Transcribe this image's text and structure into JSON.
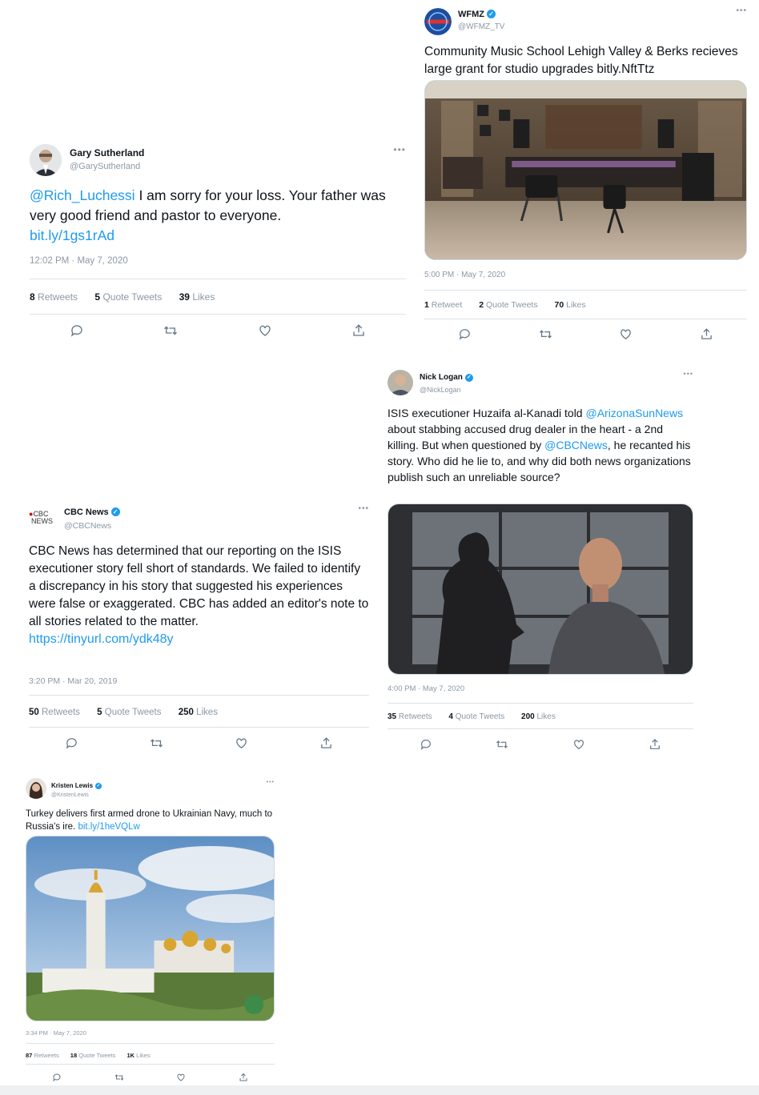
{
  "tweets": {
    "gary": {
      "name": "Gary Sutherland",
      "handle": "@GarySutherland",
      "mention": "@Rich_Luchessi",
      "text": " I am sorry for your loss. Your father was very good friend and pastor to everyone.",
      "link": "bit.ly/1gs1rAd",
      "time": "12:02 PM · May 7, 2020",
      "retweets": "8",
      "retweets_label": "Retweets",
      "quotes": "5",
      "quotes_label": "Quote Tweets",
      "likes": "39",
      "likes_label": "Likes"
    },
    "wfmz": {
      "name": "WFMZ",
      "handle": "@WFMZ_TV",
      "text": "Community Music School Lehigh Valley & Berks recieves large grant for studio upgrades bitly.NftTtz",
      "time": "5:00 PM · May 7, 2020",
      "retweets": "1",
      "retweets_label": "Retweet",
      "quotes": "2",
      "quotes_label": "Quote Tweets",
      "likes": "70",
      "likes_label": "Likes"
    },
    "nick": {
      "name": "Nick Logan",
      "handle": "@NickLogan",
      "t1": "ISIS executioner Huzaifa al-Kanadi told ",
      "m1": "@ArizonaSunNews",
      "t2": " about stabbing accused drug dealer in the heart - a 2nd killing. But when questioned by ",
      "m2": "@CBCNews",
      "t3": ", he recanted his story. Who did he lie to, and why did both news organizations publish such an unreliable source?",
      "time": "4:00 PM · May 7, 2020",
      "retweets": "35",
      "retweets_label": "Retweets",
      "quotes": "4",
      "quotes_label": "Quote Tweets",
      "likes": "200",
      "likes_label": "Likes"
    },
    "cbc": {
      "name": "CBC News",
      "handle": "@CBCNews",
      "logo_line1": "CBC",
      "logo_line2": "NEWS",
      "text": "CBC News has determined that our reporting on the ISIS executioner story fell short of standards. We failed to identify a discrepancy in his story that suggested his experiences were false or exaggerated. CBC has added an editor's note to all stories related to the matter.",
      "link": "https://tinyurl.com/ydk48y",
      "time": "3:20 PM · Mar 20, 2019",
      "retweets": "50",
      "retweets_label": "Retweets",
      "quotes": "5",
      "quotes_label": "Quote Tweets",
      "likes": "250",
      "likes_label": "Likes"
    },
    "kristen": {
      "name": "Kristen Lewis",
      "handle": "@KristenLewis",
      "text": "Turkey delivers first armed drone to Ukrainian Navy, much to Russia's ire. ",
      "link": "bit.ly/1heVQLw",
      "time": "3:34 PM · May 7, 2020",
      "retweets": "87",
      "retweets_label": "Retweets",
      "quotes": "18",
      "quotes_label": "Quote Tweets",
      "likes": "1K",
      "likes_label": "Likes"
    }
  },
  "icons": [
    "reply-icon",
    "retweet-icon",
    "like-icon",
    "share-icon",
    "more-icon",
    "verified-icon"
  ],
  "colors": {
    "link": "#1d9bf0",
    "muted": "#8b98a5",
    "text": "#0f1419"
  }
}
